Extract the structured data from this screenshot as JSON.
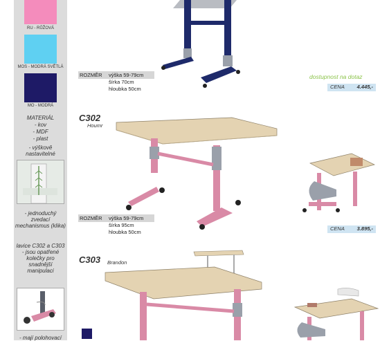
{
  "sidebar": {
    "swatches": [
      {
        "caption": "RU - RŮŽOVÁ",
        "color": "#f48cbc"
      },
      {
        "caption": "MOS - MODRÁ SVĚTLÁ",
        "color": "#5fd0f2"
      },
      {
        "caption": "MO - MODRÁ",
        "color": "#1e1a66"
      }
    ],
    "material_title": "MATERIÁL",
    "material_items": [
      "- kov",
      "- MDF",
      "- plast"
    ],
    "adjustable": "- výškově nastavitelné",
    "mechanism": "- jednoduchý zvedací mechanismus (klika)",
    "casters": "lavice C302 a C303 - jsou opatřené kolečky pro snadnější manipulaci",
    "bottom_text": "- mají polohovací"
  },
  "products": [
    {
      "size_title": "ROZMĚR",
      "size_lines": [
        "výška 59-79cm",
        "šírka 70cm",
        "hloubka 50cm"
      ],
      "availability": "dostupnost na dotaz",
      "price_label": "CENA",
      "price": "4.445,-"
    },
    {
      "code": "C302",
      "name": "Houmr",
      "size_title": "ROZMĚR",
      "size_lines": [
        "výška 59-79cm",
        "šírka 95cm",
        "hloubka 50cm"
      ],
      "price_label": "CENA",
      "price": "3.895,-"
    },
    {
      "code": "C303",
      "name": "Brandon"
    }
  ],
  "colors": {
    "navy": "#1e2a6a",
    "pink": "#d98aa6",
    "wood": "#e4d3b2",
    "price_bg": "#cfe4f2",
    "avail": "#8bc34a"
  }
}
